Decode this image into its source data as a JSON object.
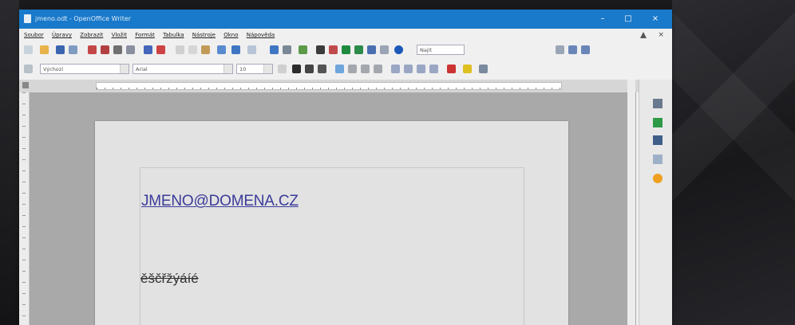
{
  "window": {
    "title": "jmeno.odt - OpenOffice Writer"
  },
  "menu": {
    "items": [
      "Soubor",
      "Úpravy",
      "Zobrazit",
      "Vložit",
      "Formát",
      "Tabulka",
      "Nástroje",
      "Okno",
      "Nápověda"
    ],
    "close_doc": "×"
  },
  "toolbar": {
    "style_value": "Výchozí",
    "font_value": "Arial",
    "size_value": "10",
    "find_value": "Najít"
  },
  "document": {
    "email": "JMENO@DOMENA.CZ",
    "czech_text": "ěščřžýáíé"
  },
  "window_controls": {
    "minimize": "–",
    "maximize": "□",
    "close": "×"
  }
}
